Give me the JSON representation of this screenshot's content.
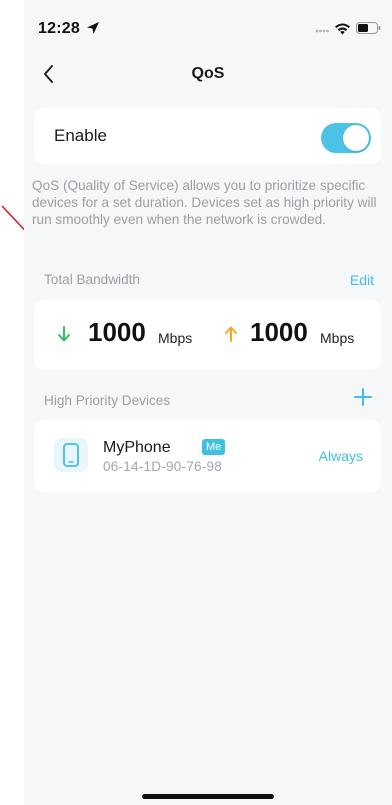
{
  "status_bar": {
    "time": "12:28",
    "icons": [
      "location-arrow-icon",
      "signal-dots-icon",
      "wifi-icon",
      "battery-icon"
    ]
  },
  "nav": {
    "title": "QoS",
    "back_icon": "chevron-left-icon"
  },
  "enable": {
    "label": "Enable",
    "state": true
  },
  "description": "QoS (Quality of Service) allows you to prioritize specific devices for a set duration. Devices set as high priority will run smoothly even when the network is crowded.",
  "bandwidth": {
    "section_label": "Total Bandwidth",
    "edit_label": "Edit",
    "download": {
      "value": "1000",
      "unit": "Mbps",
      "icon": "arrow-down-icon"
    },
    "upload": {
      "value": "1000",
      "unit": "Mbps",
      "icon": "arrow-up-icon"
    }
  },
  "high_priority": {
    "section_label": "High Priority Devices",
    "add_icon": "plus-icon",
    "devices": [
      {
        "name": "MyPhone",
        "badge": "Me",
        "mac": "06-14-1D-90-76-98",
        "status": "Always",
        "icon": "phone-icon"
      }
    ]
  },
  "colors": {
    "accent": "#3ec0e3",
    "download": "#2dbf6b",
    "upload": "#f5a623",
    "background": "#f6f7f9",
    "annotation_arrow": "#d0202b"
  }
}
